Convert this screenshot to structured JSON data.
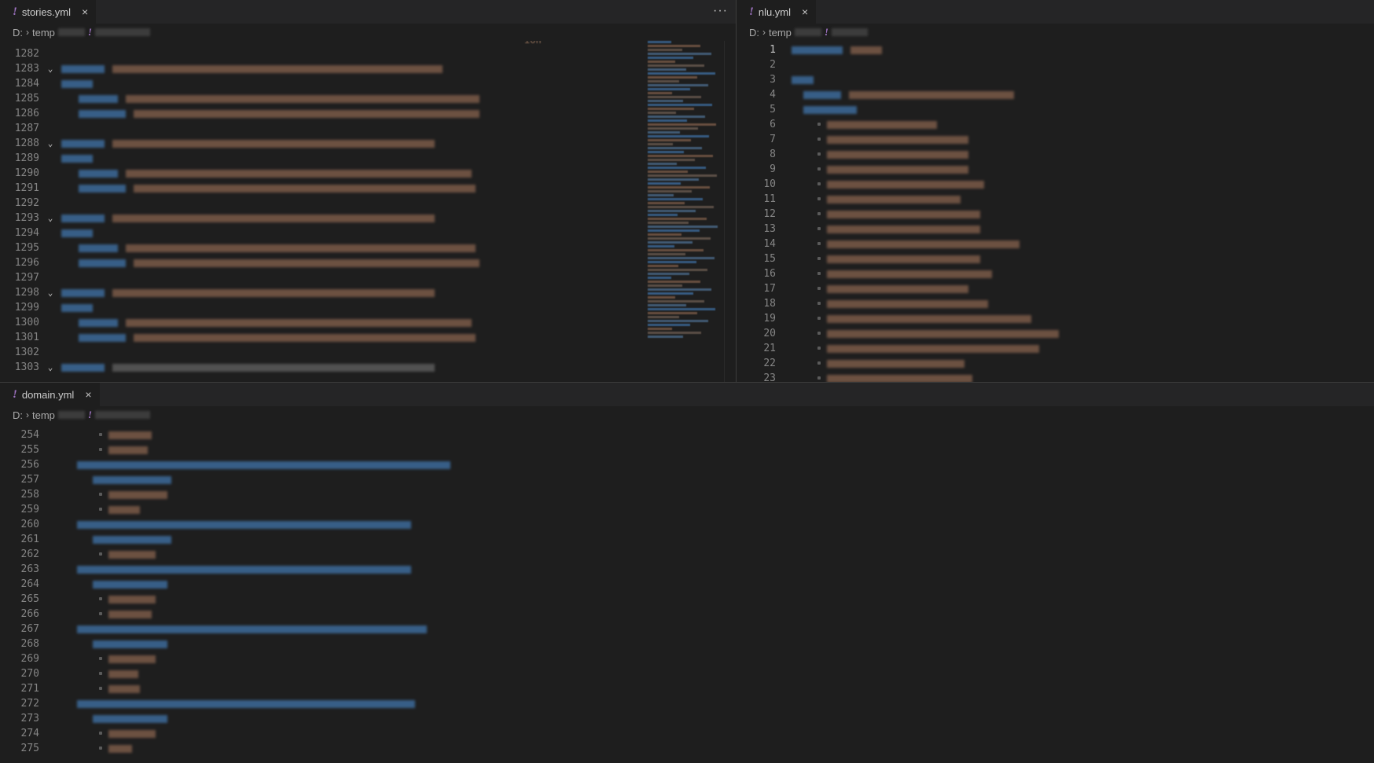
{
  "top_left": {
    "tab": {
      "icon": "!",
      "label": "stories.yml",
      "close": "×"
    },
    "more": "···",
    "breadcrumb": {
      "drive": "D:",
      "folder": "temp"
    },
    "partial_line": "ion",
    "lines": [
      {
        "n": "1282",
        "fold": "",
        "ind": 0,
        "segs": []
      },
      {
        "n": "1283",
        "fold": "⌄",
        "ind": 0,
        "segs": [
          [
            "k",
            55
          ],
          [
            "s",
            420
          ]
        ]
      },
      {
        "n": "1284",
        "fold": "",
        "ind": 0,
        "segs": [
          [
            "k",
            40
          ]
        ]
      },
      {
        "n": "1285",
        "fold": "",
        "ind": 1,
        "segs": [
          [
            "k",
            50
          ],
          [
            "s",
            450
          ]
        ]
      },
      {
        "n": "1286",
        "fold": "",
        "ind": 1,
        "segs": [
          [
            "k",
            60
          ],
          [
            "s",
            440
          ]
        ]
      },
      {
        "n": "1287",
        "fold": "",
        "ind": 0,
        "segs": []
      },
      {
        "n": "1288",
        "fold": "⌄",
        "ind": 0,
        "segs": [
          [
            "k",
            55
          ],
          [
            "s",
            410
          ]
        ]
      },
      {
        "n": "1289",
        "fold": "",
        "ind": 0,
        "segs": [
          [
            "k",
            40
          ]
        ]
      },
      {
        "n": "1290",
        "fold": "",
        "ind": 1,
        "segs": [
          [
            "k",
            50
          ],
          [
            "s",
            440
          ]
        ]
      },
      {
        "n": "1291",
        "fold": "",
        "ind": 1,
        "segs": [
          [
            "k",
            60
          ],
          [
            "s",
            435
          ]
        ]
      },
      {
        "n": "1292",
        "fold": "",
        "ind": 0,
        "segs": []
      },
      {
        "n": "1293",
        "fold": "⌄",
        "ind": 0,
        "segs": [
          [
            "k",
            55
          ],
          [
            "s",
            410
          ]
        ]
      },
      {
        "n": "1294",
        "fold": "",
        "ind": 0,
        "segs": [
          [
            "k",
            40
          ]
        ]
      },
      {
        "n": "1295",
        "fold": "",
        "ind": 1,
        "segs": [
          [
            "k",
            50
          ],
          [
            "s",
            445
          ]
        ]
      },
      {
        "n": "1296",
        "fold": "",
        "ind": 1,
        "segs": [
          [
            "k",
            60
          ],
          [
            "s",
            440
          ]
        ]
      },
      {
        "n": "1297",
        "fold": "",
        "ind": 0,
        "segs": []
      },
      {
        "n": "1298",
        "fold": "⌄",
        "ind": 0,
        "segs": [
          [
            "k",
            55
          ],
          [
            "s",
            410
          ]
        ]
      },
      {
        "n": "1299",
        "fold": "",
        "ind": 0,
        "segs": [
          [
            "k",
            40
          ]
        ]
      },
      {
        "n": "1300",
        "fold": "",
        "ind": 1,
        "segs": [
          [
            "k",
            50
          ],
          [
            "s",
            440
          ]
        ]
      },
      {
        "n": "1301",
        "fold": "",
        "ind": 1,
        "segs": [
          [
            "k",
            60
          ],
          [
            "s",
            435
          ]
        ]
      },
      {
        "n": "1302",
        "fold": "",
        "ind": 0,
        "segs": []
      },
      {
        "n": "1303",
        "fold": "⌄",
        "ind": 0,
        "segs": [
          [
            "k",
            55
          ],
          [
            "g",
            410
          ]
        ]
      }
    ]
  },
  "top_right": {
    "tab": {
      "icon": "!",
      "label": "nlu.yml",
      "close": "×"
    },
    "breadcrumb": {
      "drive": "D:",
      "folder": "temp"
    },
    "lines": [
      {
        "n": "1",
        "ind": 0,
        "segs": [
          [
            "k",
            65
          ],
          [
            "s",
            40
          ]
        ]
      },
      {
        "n": "2",
        "ind": 0,
        "segs": []
      },
      {
        "n": "3",
        "ind": 0,
        "segs": [
          [
            "k",
            28
          ]
        ]
      },
      {
        "n": "4",
        "ind": 1,
        "segs": [
          [
            "k",
            48
          ],
          [
            "s",
            210
          ]
        ]
      },
      {
        "n": "5",
        "ind": 1,
        "segs": [
          [
            "k",
            68
          ]
        ]
      },
      {
        "n": "6",
        "ind": 3,
        "segs": [
          [
            "s",
            140
          ]
        ]
      },
      {
        "n": "7",
        "ind": 3,
        "segs": [
          [
            "s",
            180
          ]
        ]
      },
      {
        "n": "8",
        "ind": 3,
        "segs": [
          [
            "s",
            180
          ]
        ]
      },
      {
        "n": "9",
        "ind": 3,
        "segs": [
          [
            "s",
            180
          ]
        ]
      },
      {
        "n": "10",
        "ind": 3,
        "segs": [
          [
            "s",
            200
          ]
        ]
      },
      {
        "n": "11",
        "ind": 3,
        "segs": [
          [
            "s",
            170
          ]
        ]
      },
      {
        "n": "12",
        "ind": 3,
        "segs": [
          [
            "s",
            195
          ]
        ]
      },
      {
        "n": "13",
        "ind": 3,
        "segs": [
          [
            "s",
            195
          ]
        ]
      },
      {
        "n": "14",
        "ind": 3,
        "segs": [
          [
            "s",
            245
          ]
        ]
      },
      {
        "n": "15",
        "ind": 3,
        "segs": [
          [
            "s",
            195
          ]
        ]
      },
      {
        "n": "16",
        "ind": 3,
        "segs": [
          [
            "s",
            210
          ]
        ]
      },
      {
        "n": "17",
        "ind": 3,
        "segs": [
          [
            "s",
            180
          ]
        ]
      },
      {
        "n": "18",
        "ind": 3,
        "segs": [
          [
            "s",
            205
          ]
        ]
      },
      {
        "n": "19",
        "ind": 3,
        "segs": [
          [
            "s",
            260
          ]
        ]
      },
      {
        "n": "20",
        "ind": 3,
        "segs": [
          [
            "s",
            295
          ]
        ]
      },
      {
        "n": "21",
        "ind": 3,
        "segs": [
          [
            "s",
            270
          ]
        ]
      },
      {
        "n": "22",
        "ind": 3,
        "segs": [
          [
            "s",
            175
          ]
        ]
      },
      {
        "n": "23",
        "ind": 3,
        "segs": [
          [
            "s",
            185
          ]
        ]
      }
    ]
  },
  "bottom": {
    "tab": {
      "icon": "!",
      "label": "domain.yml",
      "close": "×"
    },
    "breadcrumb": {
      "drive": "D:",
      "folder": "temp"
    },
    "lines": [
      {
        "n": "254",
        "ind": 3,
        "segs": [
          [
            "s",
            55
          ]
        ]
      },
      {
        "n": "255",
        "ind": 3,
        "segs": [
          [
            "s",
            50
          ]
        ]
      },
      {
        "n": "256",
        "ind": 1,
        "segs": [
          [
            "k",
            475
          ]
        ]
      },
      {
        "n": "257",
        "ind": 2,
        "segs": [
          [
            "k",
            100
          ]
        ]
      },
      {
        "n": "258",
        "ind": 3,
        "segs": [
          [
            "s",
            75
          ]
        ]
      },
      {
        "n": "259",
        "ind": 3,
        "segs": [
          [
            "s",
            40
          ]
        ]
      },
      {
        "n": "260",
        "ind": 1,
        "segs": [
          [
            "k",
            425
          ]
        ]
      },
      {
        "n": "261",
        "ind": 2,
        "segs": [
          [
            "k",
            100
          ]
        ]
      },
      {
        "n": "262",
        "ind": 3,
        "segs": [
          [
            "s",
            60
          ]
        ]
      },
      {
        "n": "263",
        "ind": 1,
        "segs": [
          [
            "k",
            425
          ]
        ]
      },
      {
        "n": "264",
        "ind": 2,
        "segs": [
          [
            "k",
            95
          ]
        ]
      },
      {
        "n": "265",
        "ind": 3,
        "segs": [
          [
            "s",
            60
          ]
        ]
      },
      {
        "n": "266",
        "ind": 3,
        "segs": [
          [
            "s",
            55
          ]
        ]
      },
      {
        "n": "267",
        "ind": 1,
        "segs": [
          [
            "k",
            445
          ]
        ]
      },
      {
        "n": "268",
        "ind": 2,
        "segs": [
          [
            "k",
            95
          ]
        ]
      },
      {
        "n": "269",
        "ind": 3,
        "segs": [
          [
            "s",
            60
          ]
        ]
      },
      {
        "n": "270",
        "ind": 3,
        "segs": [
          [
            "s",
            38
          ]
        ]
      },
      {
        "n": "271",
        "ind": 3,
        "segs": [
          [
            "s",
            40
          ]
        ]
      },
      {
        "n": "272",
        "ind": 1,
        "segs": [
          [
            "k",
            430
          ]
        ]
      },
      {
        "n": "273",
        "ind": 2,
        "segs": [
          [
            "k",
            95
          ]
        ]
      },
      {
        "n": "274",
        "ind": 3,
        "segs": [
          [
            "s",
            60
          ]
        ]
      },
      {
        "n": "275",
        "ind": 3,
        "segs": [
          [
            "s",
            30
          ]
        ]
      }
    ]
  },
  "colors": {
    "key": "#3c6a9a",
    "string": "#7a5a48",
    "background": "#1e1e1e",
    "tab_icon": "#a074c4"
  }
}
